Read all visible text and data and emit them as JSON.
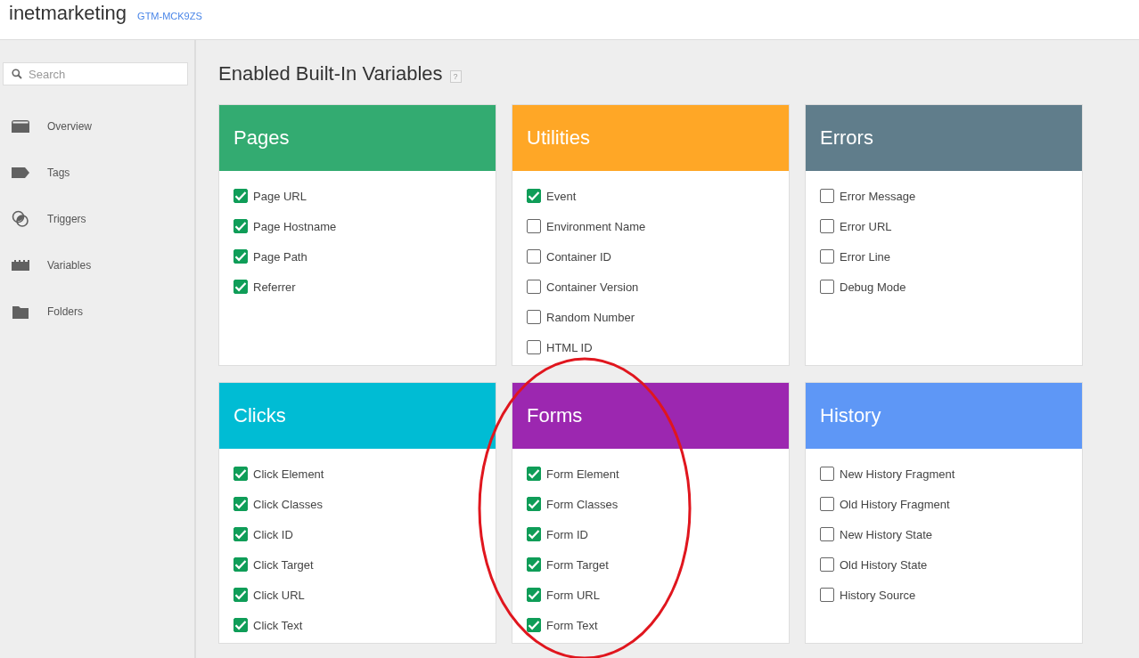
{
  "header": {
    "account": "inetmarketing",
    "container_id": "GTM-MCK9ZS"
  },
  "sidebar": {
    "search": {
      "placeholder": "Search"
    },
    "items": [
      {
        "label": "Overview",
        "kind": "overview"
      },
      {
        "label": "Tags",
        "kind": "tag"
      },
      {
        "label": "Triggers",
        "kind": "trigger"
      },
      {
        "label": "Variables",
        "kind": "variable"
      },
      {
        "label": "Folders",
        "kind": "folder"
      }
    ]
  },
  "page_title": "Enabled Built-In Variables",
  "help_mark": "?",
  "groups": [
    {
      "title": "Pages",
      "color": "#33ab71",
      "variables": [
        {
          "label": "Page URL",
          "checked": true
        },
        {
          "label": "Page Hostname",
          "checked": true
        },
        {
          "label": "Page Path",
          "checked": true
        },
        {
          "label": "Referrer",
          "checked": true
        }
      ]
    },
    {
      "title": "Utilities",
      "color": "#ffa726",
      "variables": [
        {
          "label": "Event",
          "checked": true
        },
        {
          "label": "Environment Name",
          "checked": false
        },
        {
          "label": "Container ID",
          "checked": false
        },
        {
          "label": "Container Version",
          "checked": false
        },
        {
          "label": "Random Number",
          "checked": false
        },
        {
          "label": "HTML ID",
          "checked": false
        }
      ]
    },
    {
      "title": "Errors",
      "color": "#607d8b",
      "variables": [
        {
          "label": "Error Message",
          "checked": false
        },
        {
          "label": "Error URL",
          "checked": false
        },
        {
          "label": "Error Line",
          "checked": false
        },
        {
          "label": "Debug Mode",
          "checked": false
        }
      ]
    },
    {
      "title": "Clicks",
      "color": "#00bcd4",
      "variables": [
        {
          "label": "Click Element",
          "checked": true
        },
        {
          "label": "Click Classes",
          "checked": true
        },
        {
          "label": "Click ID",
          "checked": true
        },
        {
          "label": "Click Target",
          "checked": true
        },
        {
          "label": "Click URL",
          "checked": true
        },
        {
          "label": "Click Text",
          "checked": true
        }
      ]
    },
    {
      "title": "Forms",
      "color": "#9c27b0",
      "variables": [
        {
          "label": "Form Element",
          "checked": true
        },
        {
          "label": "Form Classes",
          "checked": true
        },
        {
          "label": "Form ID",
          "checked": true
        },
        {
          "label": "Form Target",
          "checked": true
        },
        {
          "label": "Form URL",
          "checked": true
        },
        {
          "label": "Form Text",
          "checked": true
        }
      ]
    },
    {
      "title": "History",
      "color": "#5e97f6",
      "variables": [
        {
          "label": "New History Fragment",
          "checked": false
        },
        {
          "label": "Old History Fragment",
          "checked": false
        },
        {
          "label": "New History State",
          "checked": false
        },
        {
          "label": "Old History State",
          "checked": false
        },
        {
          "label": "History Source",
          "checked": false
        }
      ]
    }
  ]
}
